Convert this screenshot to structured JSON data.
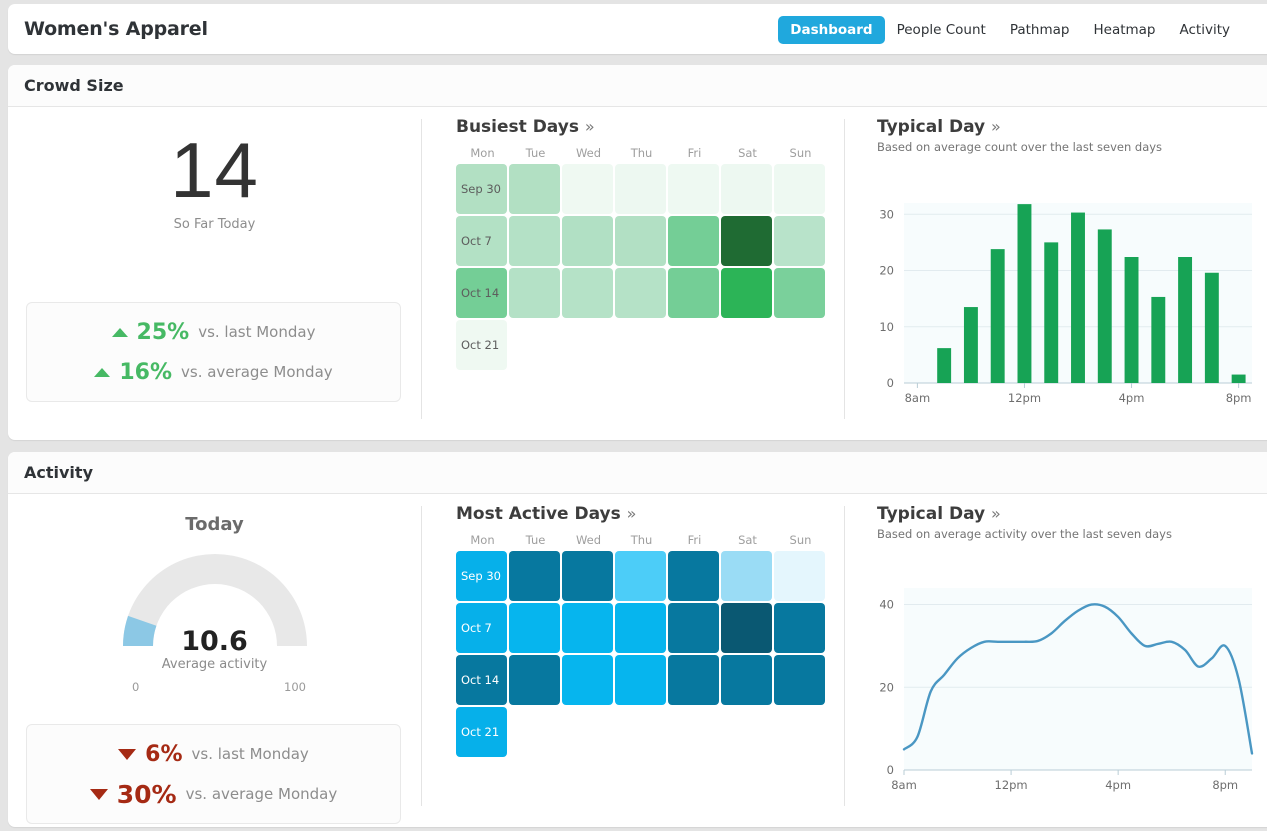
{
  "header": {
    "title": "Women's Apparel",
    "nav": [
      {
        "label": "Dashboard",
        "active": true
      },
      {
        "label": "People Count",
        "active": false
      },
      {
        "label": "Pathmap",
        "active": false
      },
      {
        "label": "Heatmap",
        "active": false
      },
      {
        "label": "Activity",
        "active": false
      }
    ]
  },
  "crowd": {
    "section_title": "Crowd Size",
    "count": "14",
    "count_caption": "So Far Today",
    "comparisons": [
      {
        "direction": "up",
        "value": "25%",
        "text": "vs. last Monday"
      },
      {
        "direction": "up",
        "value": "16%",
        "text": "vs. average Monday"
      }
    ],
    "heatmap": {
      "title": "Busiest Days",
      "chevron": "»",
      "day_headers": [
        "Mon",
        "Tue",
        "Wed",
        "Thu",
        "Fri",
        "Sat",
        "Sun"
      ],
      "week_labels": [
        "Sep 30",
        "Oct 7",
        "Oct 14",
        "Oct 21"
      ],
      "colors": [
        [
          "#b2e0c3",
          "#b2e0c3",
          "#eff9f2",
          "#edf8f1",
          "#eef9f2",
          "#edf8f1",
          "#eef9f2"
        ],
        [
          "#b3e1c5",
          "#b4e1c6",
          "#b1e0c4",
          "#b2e0c4",
          "#74ce96",
          "#1f6b33",
          "#b8e3ca"
        ],
        [
          "#74ce96",
          "#b4e1c6",
          "#b5e2c7",
          "#b5e2c7",
          "#74ce96",
          "#2cb457",
          "#7ad09b"
        ],
        [
          "#eff9f2",
          null,
          null,
          null,
          null,
          null,
          null
        ]
      ]
    },
    "chart_title": "Typical Day",
    "chart_sub": "Based on average count over the last seven days"
  },
  "activity": {
    "section_title": "Activity",
    "today_label": "Today",
    "gauge": {
      "value": "10.6",
      "caption": "Average activity",
      "min": "0",
      "max": "100",
      "arc_color": "#8cc8e5",
      "track_color": "#e8e8e8"
    },
    "comparisons": [
      {
        "direction": "down",
        "value": "6%",
        "text": "vs. last Monday"
      },
      {
        "direction": "down",
        "value": "30%",
        "text": "vs. average Monday"
      }
    ],
    "heatmap": {
      "title": "Most Active Days",
      "chevron": "»",
      "day_headers": [
        "Mon",
        "Tue",
        "Wed",
        "Thu",
        "Fri",
        "Sat",
        "Sun"
      ],
      "week_labels": [
        "Sep 30",
        "Oct 7",
        "Oct 14",
        "Oct 21"
      ],
      "colors": [
        [
          "#06b0ea",
          "#07789f",
          "#07789f",
          "#4ccdf8",
          "#07789f",
          "#9adcf5",
          "#e4f6fd"
        ],
        [
          "#06b0ea",
          "#06b5ee",
          "#06b5ee",
          "#06b5ee",
          "#07789f",
          "#0a5872",
          "#07789f"
        ],
        [
          "#07789f",
          "#07789f",
          "#06b5ee",
          "#06b5ee",
          "#07789f",
          "#07789f",
          "#07789f"
        ],
        [
          "#06b0ea",
          null,
          null,
          null,
          null,
          null,
          null
        ]
      ]
    },
    "chart_title": "Typical Day",
    "chart_sub": "Based on average activity over the last seven days"
  },
  "chart_data": [
    {
      "type": "bar",
      "title": "Typical Day",
      "subtitle": "Based on average count over the last seven days",
      "xlabel": "",
      "ylabel": "",
      "ylim": [
        0,
        32
      ],
      "yticks": [
        0,
        10,
        20,
        30
      ],
      "xticks": [
        "8am",
        "12pm",
        "4pm",
        "8pm"
      ],
      "xtick_hours": [
        8,
        12,
        16,
        20
      ],
      "categories": [
        "8am",
        "9am",
        "10am",
        "11am",
        "12pm",
        "1pm",
        "2pm",
        "3pm",
        "4pm",
        "5pm",
        "6pm",
        "7pm",
        "8pm"
      ],
      "values": [
        0,
        6.2,
        13.5,
        23.8,
        31.8,
        25.0,
        30.3,
        27.3,
        22.4,
        15.3,
        22.4,
        19.6,
        1.5
      ],
      "bar_color": "#17a355",
      "grid": true,
      "legend": "none"
    },
    {
      "type": "line",
      "title": "Typical Day",
      "subtitle": "Based on average activity over the last seven days",
      "xlabel": "",
      "ylabel": "",
      "ylim": [
        0,
        44
      ],
      "yticks": [
        0,
        20,
        40
      ],
      "xticks": [
        "8am",
        "12pm",
        "4pm",
        "8pm"
      ],
      "xtick_hours": [
        8,
        12,
        16,
        20
      ],
      "x": [
        8,
        8.5,
        9,
        9.5,
        10,
        10.5,
        11,
        11.5,
        12,
        12.5,
        13,
        13.5,
        14,
        14.5,
        15,
        15.5,
        16,
        16.5,
        17,
        17.5,
        18,
        18.5,
        19,
        19.5,
        20,
        20.5,
        21
      ],
      "y": [
        5,
        8,
        19,
        23,
        27,
        29.5,
        31,
        31,
        31,
        31,
        31.2,
        33,
        36,
        38.5,
        40,
        39.5,
        37,
        33,
        30,
        30.5,
        31,
        29,
        25,
        27,
        30,
        22,
        4
      ],
      "line_color": "#4a97c3",
      "grid": true,
      "legend": "none"
    }
  ]
}
